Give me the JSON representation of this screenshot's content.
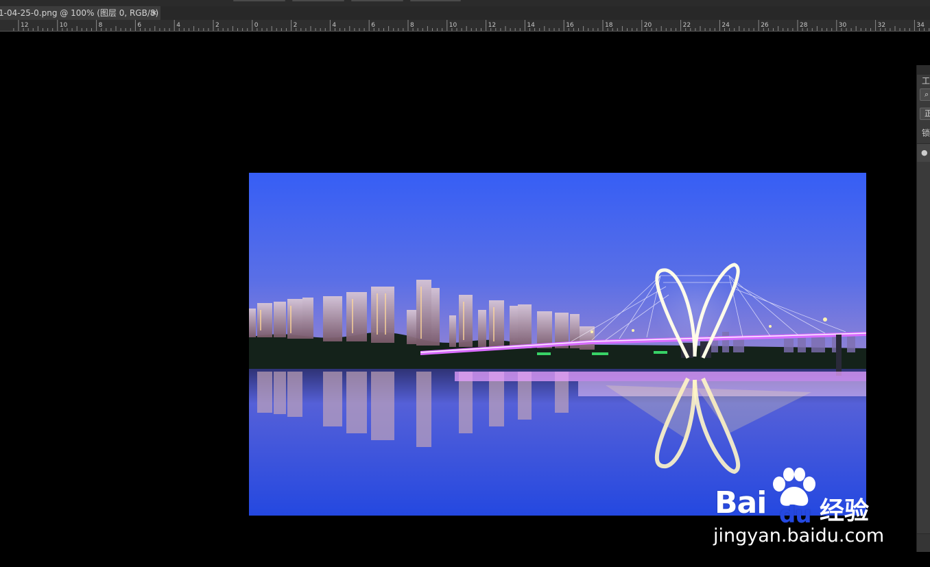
{
  "document_tab": {
    "title": "1-04-25-0.png @ 100% (图层 0, RGB/8)",
    "close_symbol": "×"
  },
  "ruler": {
    "labels": [
      "12",
      "10",
      "8",
      "6",
      "4",
      "2",
      "0",
      "2",
      "4",
      "6",
      "8",
      "10",
      "12",
      "14",
      "16",
      "18",
      "20",
      "22",
      "24",
      "26",
      "28",
      "30",
      "32",
      "34"
    ]
  },
  "right_panel": {
    "header_label": "工",
    "search_icon": "search-icon",
    "mode_label": "正",
    "lock_label": "锁",
    "visibility_icon": "eye-icon"
  },
  "watermark": {
    "brand_bai": "Bai",
    "brand_du": "du",
    "brand_cn": "经验",
    "url": "jingyan.baidu.com"
  },
  "colors": {
    "canvas_bg": "#000000",
    "sky_top": "#3a5cf0",
    "sky_bottom": "#7a7bd8",
    "water": "#3b55e6",
    "ruler_bg": "#2e2e2e",
    "tab_bg": "#3c3c3c"
  }
}
